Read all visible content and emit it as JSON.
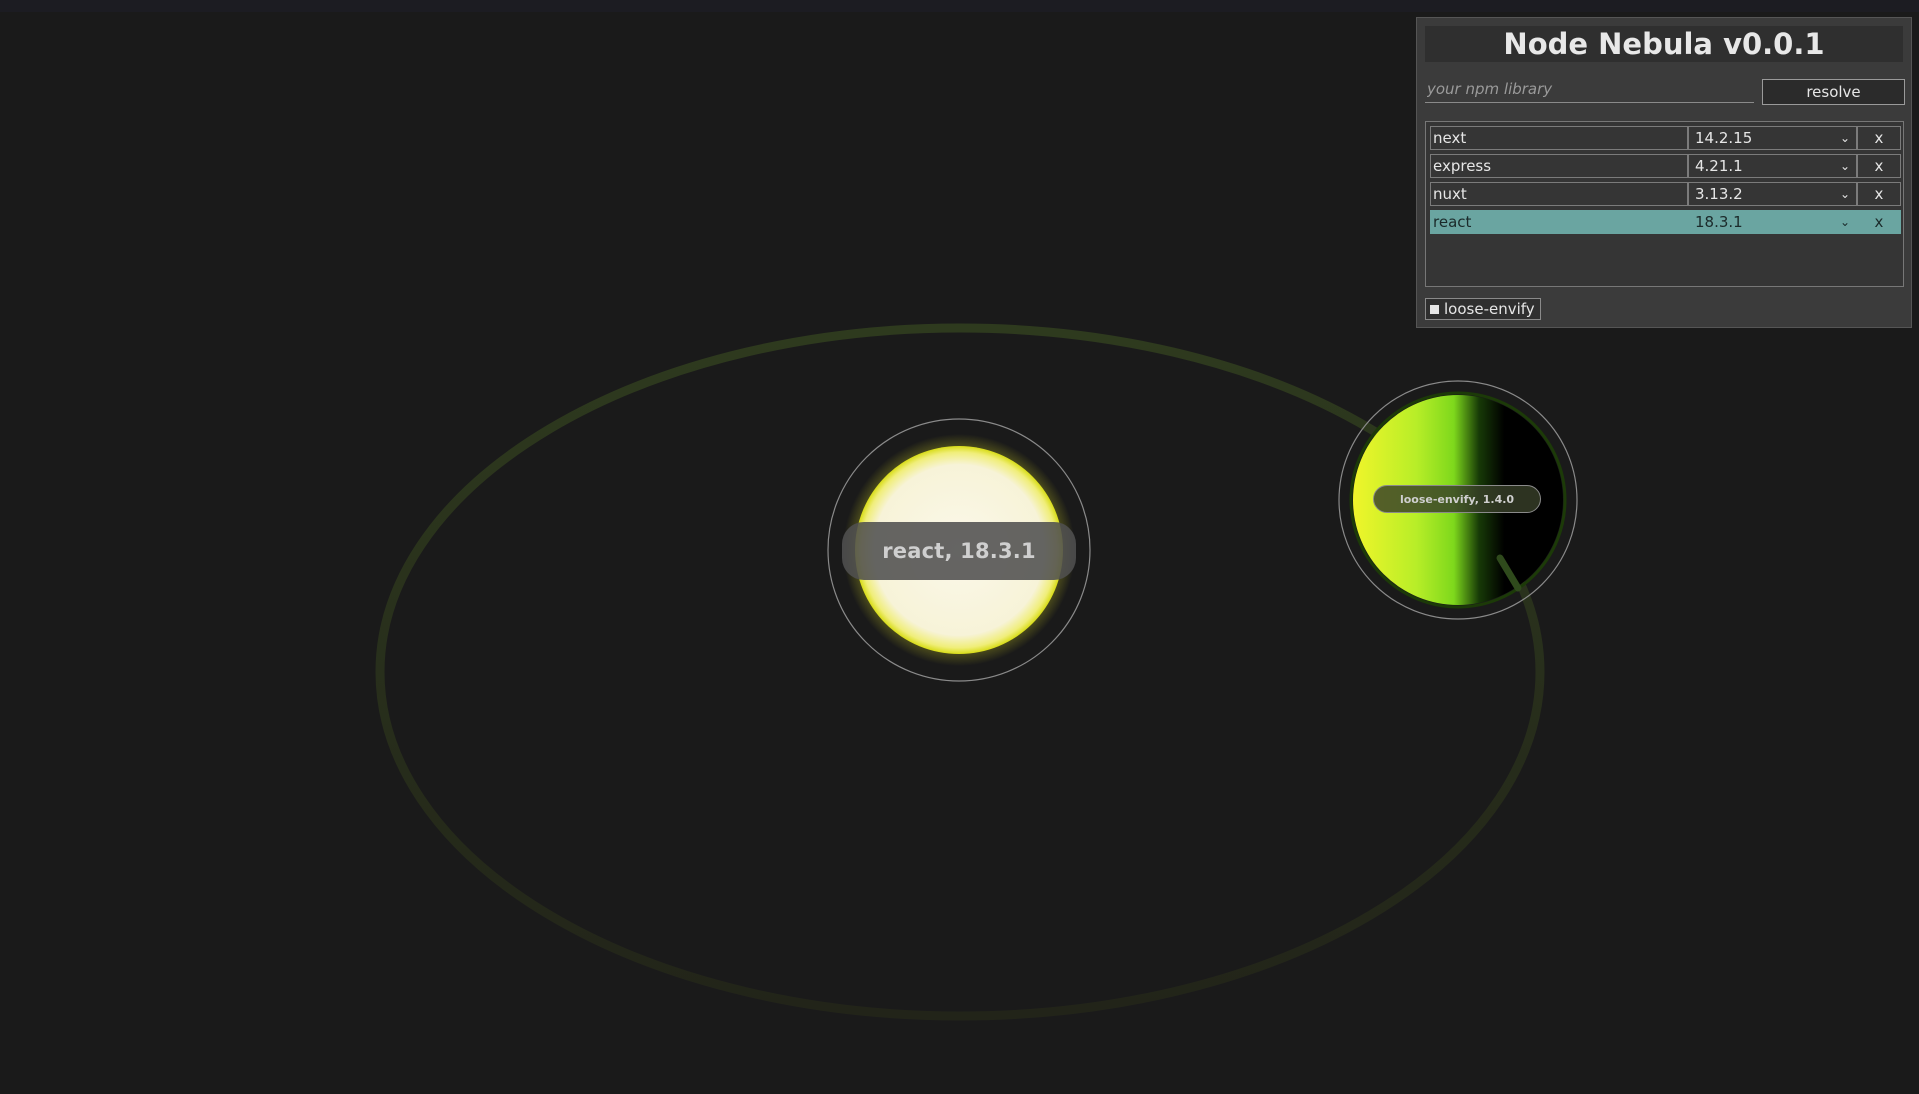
{
  "app": {
    "title": "Node Nebula v0.0.1"
  },
  "search": {
    "placeholder": "your npm library",
    "value": "",
    "resolve_label": "resolve"
  },
  "dependencies": [
    {
      "name": "next",
      "version": "14.2.15",
      "remove_label": "x",
      "selected": false
    },
    {
      "name": "express",
      "version": "4.21.1",
      "remove_label": "x",
      "selected": false
    },
    {
      "name": "nuxt",
      "version": "3.13.2",
      "remove_label": "x",
      "selected": false
    },
    {
      "name": "react",
      "version": "18.3.1",
      "remove_label": "x",
      "selected": true
    }
  ],
  "resolved_chips": [
    {
      "label": "loose-envify"
    }
  ],
  "scene": {
    "sun": {
      "label": "react, 18.3.1",
      "color": "#f5f2dc",
      "glow": "#e8ea2a"
    },
    "planet": {
      "label": "loose-envify, 1.4.0",
      "color": "#c8f028"
    },
    "orbit_color": "#2b3320",
    "background": "#1a1a1a"
  },
  "colors": {
    "selected_row": "#6aa5a1",
    "panel_bg": "#3b3b3b"
  }
}
